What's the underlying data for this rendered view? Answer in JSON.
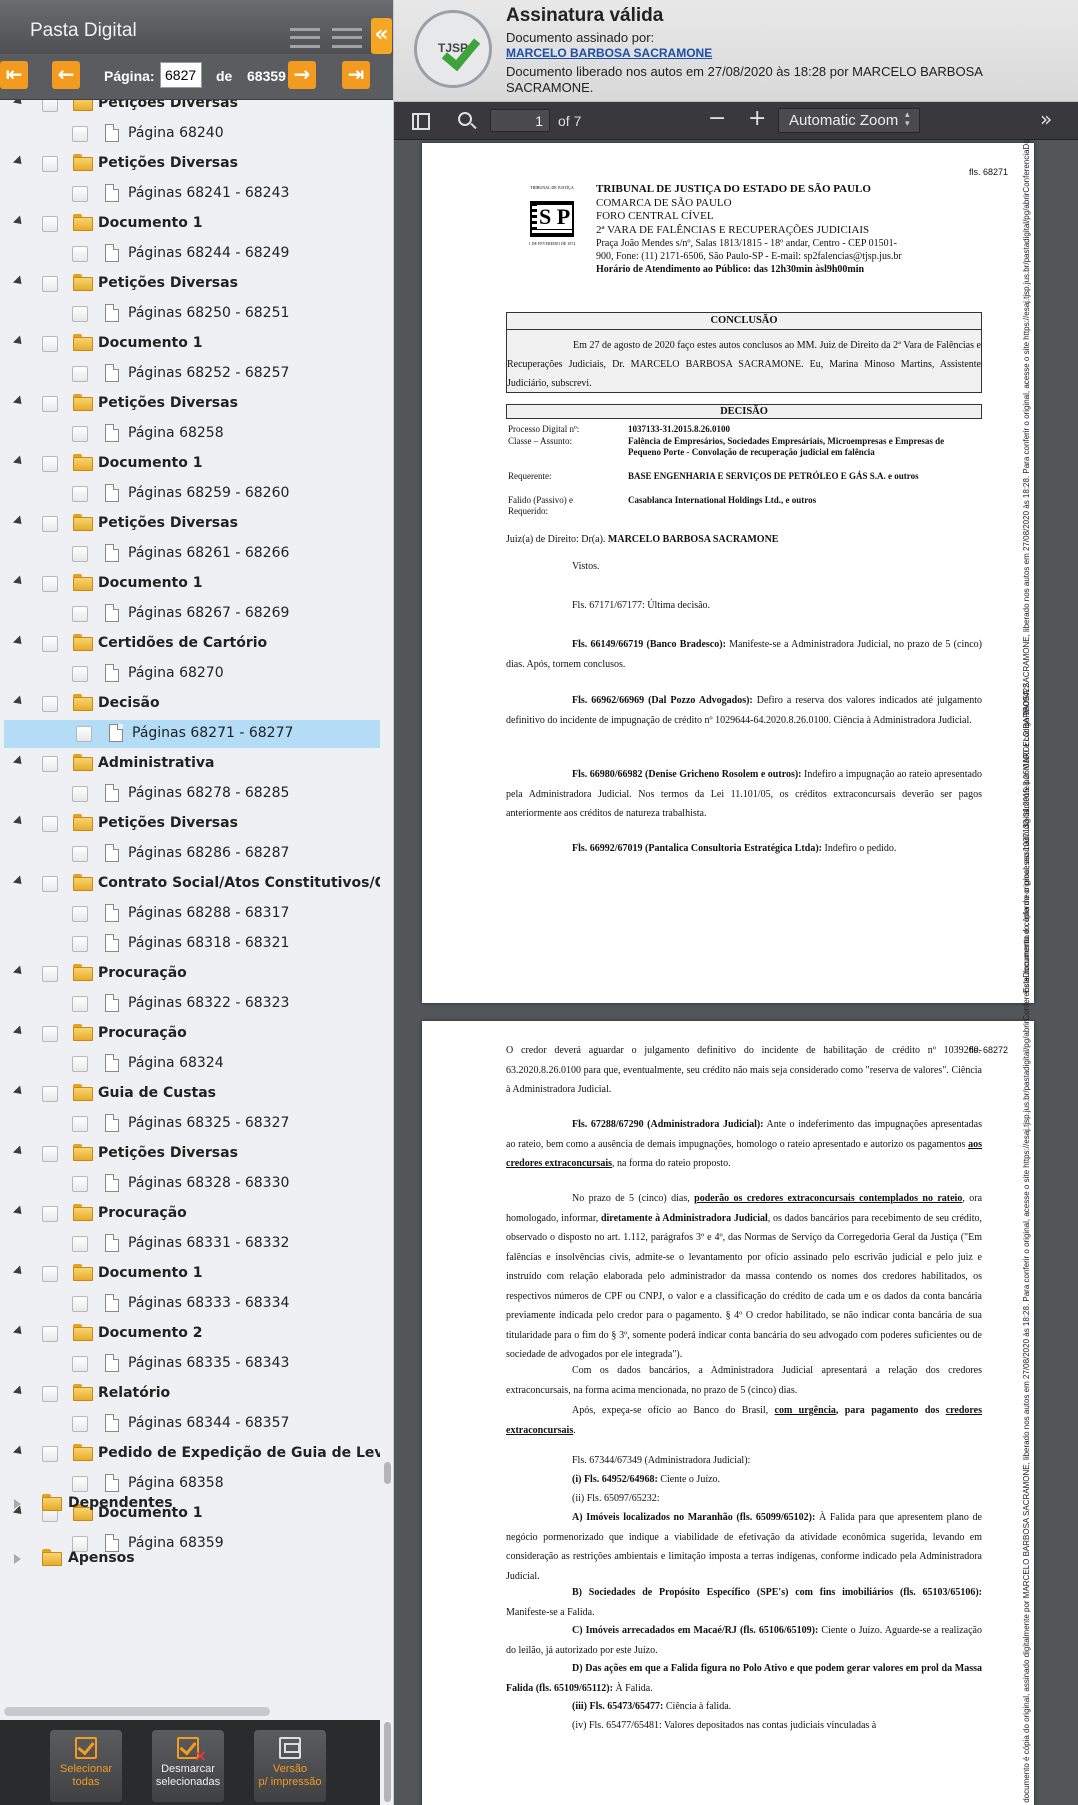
{
  "left_panel": {
    "title": "Pasta Digital",
    "pager": {
      "label_page": "Página:",
      "current": "6827",
      "label_of": "de",
      "total": "68359"
    },
    "tree": [
      {
        "type": "folder",
        "label": "Petições Diversas"
      },
      {
        "type": "page",
        "label": "Página 68240"
      },
      {
        "type": "folder",
        "label": "Petições Diversas"
      },
      {
        "type": "page",
        "label": "Páginas 68241 - 68243"
      },
      {
        "type": "folder",
        "label": "Documento 1"
      },
      {
        "type": "page",
        "label": "Páginas 68244 - 68249"
      },
      {
        "type": "folder",
        "label": "Petições Diversas"
      },
      {
        "type": "page",
        "label": "Páginas 68250 - 68251"
      },
      {
        "type": "folder",
        "label": "Documento 1"
      },
      {
        "type": "page",
        "label": "Páginas 68252 - 68257"
      },
      {
        "type": "folder",
        "label": "Petições Diversas"
      },
      {
        "type": "page",
        "label": "Página 68258"
      },
      {
        "type": "folder",
        "label": "Documento 1"
      },
      {
        "type": "page",
        "label": "Páginas 68259 - 68260"
      },
      {
        "type": "folder",
        "label": "Petições Diversas"
      },
      {
        "type": "page",
        "label": "Páginas 68261 - 68266"
      },
      {
        "type": "folder",
        "label": "Documento 1"
      },
      {
        "type": "page",
        "label": "Páginas 68267 - 68269"
      },
      {
        "type": "folder",
        "label": "Certidões de Cartório"
      },
      {
        "type": "page",
        "label": "Página 68270"
      },
      {
        "type": "folder",
        "label": "Decisão"
      },
      {
        "type": "page",
        "label": "Páginas 68271 - 68277",
        "selected": true
      },
      {
        "type": "folder",
        "label": "Administrativa"
      },
      {
        "type": "page",
        "label": "Páginas 68278 - 68285"
      },
      {
        "type": "folder",
        "label": "Petições Diversas"
      },
      {
        "type": "page",
        "label": "Páginas 68286 - 68287"
      },
      {
        "type": "folder",
        "label": "Contrato Social/Atos Constitutivos/Cart"
      },
      {
        "type": "page",
        "label": "Páginas 68288 - 68317"
      },
      {
        "type": "page",
        "label": "Páginas 68318 - 68321"
      },
      {
        "type": "folder",
        "label": "Procuração"
      },
      {
        "type": "page",
        "label": "Páginas 68322 - 68323"
      },
      {
        "type": "folder",
        "label": "Procuração"
      },
      {
        "type": "page",
        "label": "Página 68324"
      },
      {
        "type": "folder",
        "label": "Guia de Custas"
      },
      {
        "type": "page",
        "label": "Páginas 68325 - 68327"
      },
      {
        "type": "folder",
        "label": "Petições Diversas"
      },
      {
        "type": "page",
        "label": "Páginas 68328 - 68330"
      },
      {
        "type": "folder",
        "label": "Procuração"
      },
      {
        "type": "page",
        "label": "Páginas 68331 - 68332"
      },
      {
        "type": "folder",
        "label": "Documento 1"
      },
      {
        "type": "page",
        "label": "Páginas 68333 - 68334"
      },
      {
        "type": "folder",
        "label": "Documento 2"
      },
      {
        "type": "page",
        "label": "Páginas 68335 - 68343"
      },
      {
        "type": "folder",
        "label": "Relatório"
      },
      {
        "type": "page",
        "label": "Páginas 68344 - 68357"
      },
      {
        "type": "folder",
        "label": "Pedido de Expedição de Guia de Levanta"
      },
      {
        "type": "page",
        "label": "Página 68358"
      },
      {
        "type": "folder",
        "label": "Documento 1"
      },
      {
        "type": "page",
        "label": "Página 68359"
      }
    ],
    "roots": [
      "Dependentes",
      "Apensos"
    ],
    "bottom_buttons": [
      {
        "line1": "Selecionar",
        "line2": "todas"
      },
      {
        "line1": "Desmarcar",
        "line2": "selecionadas"
      },
      {
        "line1": "Versão",
        "line2": "p/ impressão"
      }
    ]
  },
  "signature": {
    "seal_text": "TJSP",
    "title": "Assinatura válida",
    "signed_by_label": "Documento assinado por:",
    "signer": "MARCELO BARBOSA SACRAMONE",
    "released": "Documento liberado nos autos em 27/08/2020 às 18:28 por MARCELO BARBOSA SACRAMONE."
  },
  "pdf_toolbar": {
    "page": "1",
    "of": "of 7",
    "zoom": "Automatic Zoom"
  },
  "page1": {
    "fls": "fls. 68271",
    "court": [
      "TRIBUNAL DE JUSTIÇA DO ESTADO DE SÃO PAULO",
      "COMARCA DE SÃO PAULO",
      "FORO CENTRAL CÍVEL",
      "2ª VARA DE FALÊNCIAS E RECUPERAÇÕES JUDICIAIS",
      "Praça João Mendes s/nº, Salas 1813/1815 - 18º andar, Centro - CEP 01501-900, Fone: (11) 2171-6506, São Paulo-SP - E-mail: sp2falencias@tjsp.jus.br"
    ],
    "hours": "Horário de Atendimento ao Público: das 12h30min àsl9h00min",
    "crest_top": "TRIBUNAL DE JUSTIÇA",
    "crest_mid": "S P",
    "crest_date": "1 DE FEVEREIRO DE 1874",
    "conclusao_title": "CONCLUSÃO",
    "conclusao_text": "Em 27 de agosto de 2020 faço estes autos conclusos ao MM. Juiz de Direito da 2ª Vara de Falências e Recuperações Judiciais, Dr. MARCELO BARBOSA SACRAMONE. Eu, Marina Minoso Martins, Assistente Judiciário, subscrevi.",
    "decisao_title": "DECISÃO",
    "process": [
      {
        "k": "Processo Digital nº:",
        "v": "1037133-31.2015.8.26.0100"
      },
      {
        "k": "Classe – Assunto:",
        "v": "Falência de Empresários, Sociedades Empresáriais, Microempresas e Empresas de Pequeno Porte - Convolação de recuperação judicial em falência"
      },
      {
        "k": "Requerente:",
        "v": "BASE ENGENHARIA E SERVIÇOS DE PETRÓLEO E GÁS S.A. e outros"
      },
      {
        "k": "Falido (Passivo) e Requerido:",
        "v": "Casablanca International Holdings Ltd., e outros"
      }
    ],
    "judge_label": "Juiz(a) de Direito: Dr(a).",
    "judge": "MARCELO BARBOSA SACRAMONE",
    "vistos": "Vistos.",
    "p1_b": "Fls. 67171/67177: Última decisão.",
    "p2_b": "Fls. 66149/66719 (Banco Bradesco):",
    "p2": " Manifeste-se a Administradora Judicial, no prazo de 5 (cinco) dias. Após, tornem conclusos.",
    "p3_b": "Fls. 66962/66969 (Dal Pozzo Advogados):",
    "p3": " Defiro a reserva dos valores indicados até julgamento definitivo do incidente de impugnação de crédito nº 1029644-64.2020.8.26.0100. Ciência à Administradora Judicial.",
    "p4_b": "Fls. 66980/66982 (Denise Gricheno Rosolem e outros):",
    "p4": " Indefiro a impugnação ao rateio apresentado pela Administradora Judicial. Nos termos da Lei 11.101/05, os créditos extraconcursais deverão ser pagos anteriormente aos créditos de natureza trabalhista.",
    "p5_b": "Fls. 66992/67019 (Pantalica Consultoria Estratégica Ltda):",
    "p5": " Indefiro o pedido.",
    "side_note": "Este documento é cópia do original, assinado digitalmente por MARCELO BARBOSA SACRAMONE, liberado nos autos em 27/08/2020 às 18:28. Para conferir o original, acesse o site https://esaj.tjsp.jus.br/pastadigital/pg/abrirConferenciaDocumento.do, informe o processo 1037133-31.2015.8.26.0100 e código 9A09422."
  },
  "page2": {
    "fls": "fls. 68272",
    "a1": "O credor deverá aguardar o julgamento definitivo do incidente de habilitação de crédito nº 1039260-63.2020.8.26.0100 para que, eventualmente, seu crédito não mais seja considerado como \"reserva de valores\". Ciência à Administradora Judicial.",
    "a2_b": "Fls. 67288/67290 (Administradora Judicial):",
    "a2": " Ante o indeferimento das impugnações apresentadas ao rateio, bem como a ausência de demais impugnações, homologo o rateio apresentado e autorizo os pagamentos ",
    "a2_u": "aos credores extraconcursais",
    "a2_end": ", na forma do rateio proposto.",
    "a3_pre": "No prazo de 5 (cinco) dias, ",
    "a3_u": "poderão os credores extraconcursais contemplados no rateio",
    "a3_mid": ", ora homologado, informar, ",
    "a3_b": "diretamente à Administradora Judicial",
    "a3": ", os dados bancários para recebimento de seu crédito, observado o disposto no art. 1.112, parágrafos 3º e 4º, das Normas de Serviço da Corregedoria Geral da Justiça (\"Em falências e insolvências civis, admite-se o levantamento por ofício assinado pelo escrivão judicial e pelo juiz e instruído com relação elaborada pelo administrador da massa contendo os nomes dos credores habilitados, os respectivos números de CPF ou CNPJ, o valor e a classificação do crédito de cada um e os dados da conta bancária previamente indicada pelo credor para o pagamento. § 4º O credor habilitado, se não indicar conta bancária de sua titularidade para o fim do § 3º, somente poderá indicar conta bancária do seu advogado com poderes suficientes ou de sociedade de advogados por ele integrada\").",
    "a4": "Com os dados bancários, a Administradora Judicial apresentará a relação dos credores extraconcursais, na forma acima mencionada, no prazo de 5 (cinco) dias.",
    "a5_pre": "Após, expeça-se ofício ao Banco do Brasil, ",
    "a5_u": "com urgência",
    "a5_b": ", para pagamento dos ",
    "a5_u2": "credores extraconcursais",
    "a5_end": ".",
    "a6": "Fls. 67344/67349 (Administradora Judicial):",
    "a7_b": "(i) Fls. 64952/64968:",
    "a7": " Ciente o Juízo.",
    "a8": "(ii) Fls. 65097/65232:",
    "a9_b": "A) Imóveis localizados no Maranhão (fls. 65099/65102):",
    "a9": " À Falida para que apresentem plano de negócio pormenorizado que indique a viabilidade de efetivação da atividade econômica sugerida, levando em consideração as restrições ambientais e limitação imposta a terras indígenas, conforme indicado pela Administradora Judicial.",
    "a10_b": "B) Sociedades de Propósito Específico (SPE's) com fins imobiliários (fls. 65103/65106):",
    "a10": " Manifeste-se a Falida.",
    "a11_b": "C) Imóveis arrecadados em Macaé/RJ (fls. 65106/65109):",
    "a11": " Ciente o Juízo. Aguarde-se a realização do leilão, já autorizado por este Juízo.",
    "a12_b": "D) Das ações em que a Falida figura no Polo Ativo e que podem gerar valores em prol da Massa Falida (fls. 65109/65112):",
    "a12": " À Falida.",
    "a13_b": "(iii) Fls. 65473/65477:",
    "a13": " Ciência à falida.",
    "a14": "(iv) Fls. 65477/65481: Valores depositados nas contas judiciais vinculadas à",
    "side_note": "Este documento é cópia do original, assinado digitalmente por MARCELO BARBOSA SACRAMONE, liberado nos autos em 27/08/2020 às 18:28. Para conferir o original, acesse o site https://esaj.tjsp.jus.br/pastadigital/pg/abrirConferenciaDocumento.do, informe o processo 1037133-31.2015.8.26.0100 e código 9A09422."
  }
}
